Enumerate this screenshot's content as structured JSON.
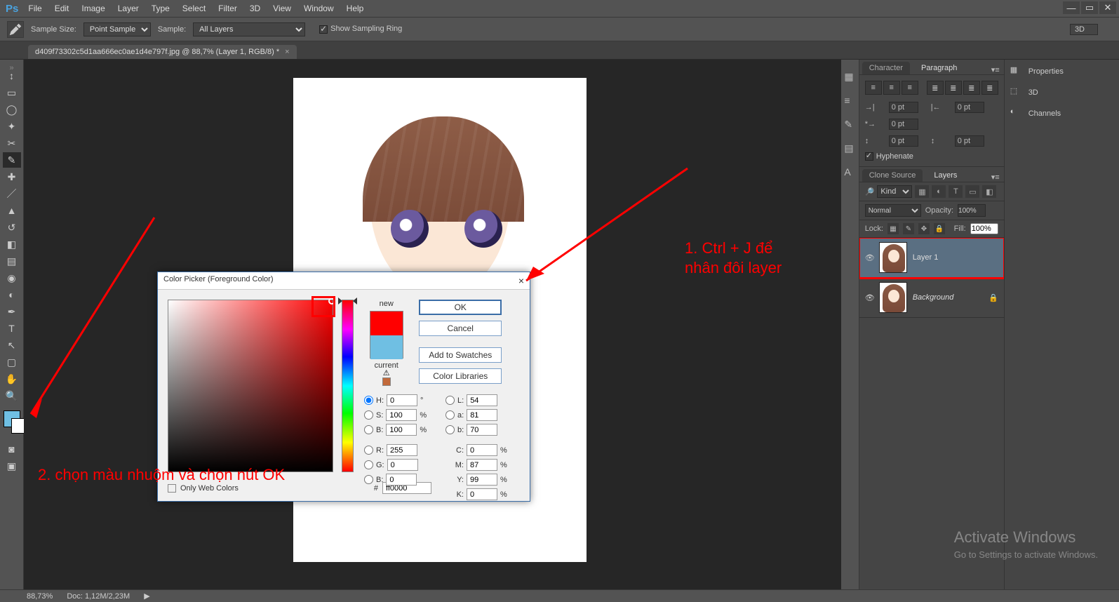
{
  "menu": {
    "items": [
      "File",
      "Edit",
      "Image",
      "Layer",
      "Type",
      "Select",
      "Filter",
      "3D",
      "View",
      "Window",
      "Help"
    ]
  },
  "optionsbar": {
    "sample_size_label": "Sample Size:",
    "sample_size_value": "Point Sample",
    "sample_label": "Sample:",
    "sample_value": "All Layers",
    "show_ring": "Show Sampling Ring",
    "workspace_mode": "3D"
  },
  "doc_tab": {
    "title": "d409f73302c5d1aa666ec0ae1d4e797f.jpg @ 88,7%  (Layer 1, RGB/8) *"
  },
  "status": {
    "zoom": "88,73%",
    "doc": "Doc:  1,12M/2,23M"
  },
  "right_tabs": {
    "character": "Character",
    "paragraph": "Paragraph",
    "clone": "Clone Source",
    "layers": "Layers"
  },
  "paragraph": {
    "indent_value": "0 pt",
    "hyphenate": "Hyphenate"
  },
  "sidebar_right": {
    "properties": "Properties",
    "threeD": "3D",
    "channels": "Channels"
  },
  "layers": {
    "kind": "Kind",
    "mode": "Normal",
    "opacity_label": "Opacity:",
    "opacity_value": "100%",
    "lock_label": "Lock:",
    "fill_label": "Fill:",
    "fill_value": "100%",
    "items": [
      {
        "name": "Layer 1",
        "selected": true
      },
      {
        "name": "Background",
        "locked": true
      }
    ]
  },
  "colorpicker": {
    "title": "Color Picker (Foreground Color)",
    "new_label": "new",
    "current_label": "current",
    "ok": "OK",
    "cancel": "Cancel",
    "add_swatch": "Add to Swatches",
    "libs": "Color Libraries",
    "H": "0",
    "S": "100",
    "B": "100",
    "R": "255",
    "G": "0",
    "Bb": "0",
    "L": "54",
    "a": "81",
    "b2": "70",
    "C": "0",
    "M": "87",
    "Y": "99",
    "K": "0",
    "hex": "ff0000",
    "only_web": "Only Web Colors",
    "labels": {
      "H": "H:",
      "S": "S:",
      "B": "B:",
      "R": "R:",
      "G": "G:",
      "Bb": "B:",
      "L": "L:",
      "a": "a:",
      "b2": "b:",
      "C": "C:",
      "M": "M:",
      "Y": "Y:",
      "K": "K:",
      "deg": "°",
      "pct": "%",
      "hash": "#"
    }
  },
  "annotations": {
    "one": "1. Ctrl + J để\nnhân đôi layer",
    "two": "2. chọn màu nhuộm và chọn nút OK"
  },
  "watermark": {
    "line1": "Activate Windows",
    "line2": "Go to Settings to activate Windows."
  }
}
